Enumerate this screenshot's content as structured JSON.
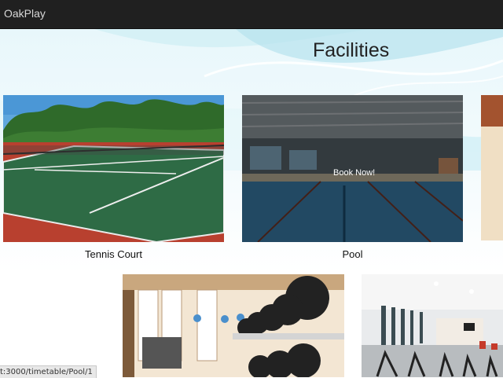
{
  "app": {
    "brand": "OakPlay"
  },
  "page": {
    "title": "Facilities"
  },
  "facilities": [
    {
      "label": "Tennis Court"
    },
    {
      "label": "Pool",
      "action": "Book Now!"
    }
  ],
  "statusbar": {
    "url": "t:3000/timetable/Pool/1"
  }
}
